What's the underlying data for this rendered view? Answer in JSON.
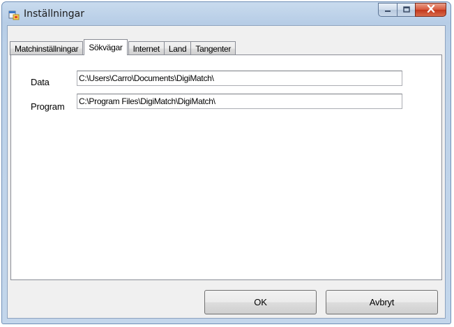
{
  "window": {
    "title": "Inställningar"
  },
  "tabs": [
    {
      "label": "Matchinställningar",
      "active": false
    },
    {
      "label": "Sökvägar",
      "active": true
    },
    {
      "label": "Internet",
      "active": false
    },
    {
      "label": "Land",
      "active": false
    },
    {
      "label": "Tangenter",
      "active": false
    }
  ],
  "fields": {
    "data": {
      "label": "Data",
      "value": "C:\\Users\\Carro\\Documents\\DigiMatch\\"
    },
    "program": {
      "label": "Program",
      "value": "C:\\Program Files\\DigiMatch\\DigiMatch\\"
    }
  },
  "buttons": {
    "ok_label": "OK",
    "cancel_label": "Avbryt"
  },
  "icons": {
    "app": "window-app-icon",
    "minimize": "minimize-icon",
    "maximize": "maximize-icon",
    "close": "close-icon"
  },
  "colors": {
    "titlebar": "#c9dbee",
    "close_button": "#c2361b",
    "client_bg": "#f0f0f0"
  }
}
